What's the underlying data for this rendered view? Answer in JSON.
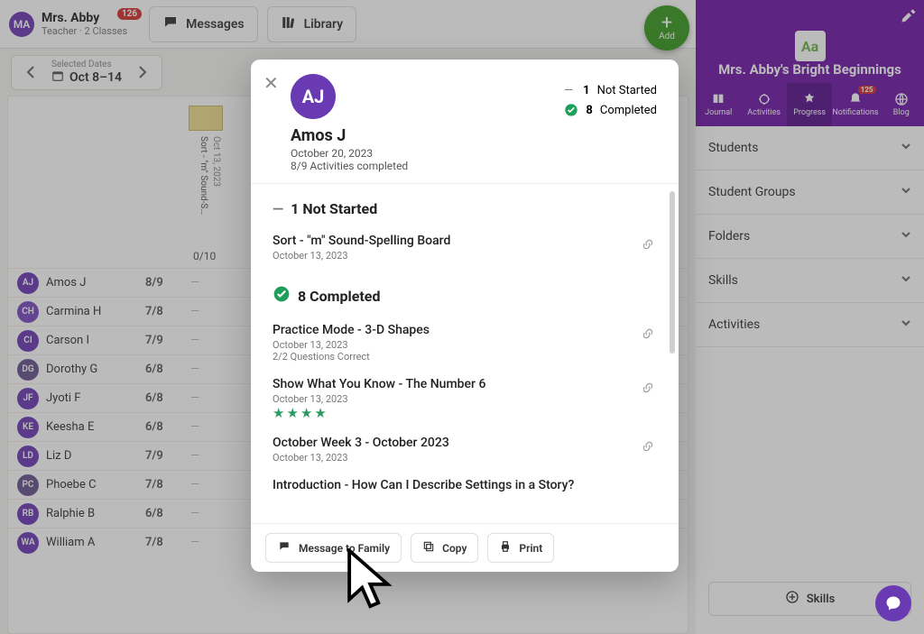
{
  "topbar": {
    "user_initials": "MA",
    "user_name": "Mrs. Abby",
    "user_role": "Teacher · 2 Classes",
    "badge": "126",
    "messages_label": "Messages",
    "library_label": "Library"
  },
  "add_fab": {
    "label": "Add"
  },
  "datebar": {
    "selected_label": "Selected Dates",
    "range": "Oct 8–14"
  },
  "column": {
    "activity_title": "Sort - \"m\" Sound-S…",
    "activity_date": "Oct 13, 2023",
    "counter": "0/10"
  },
  "students": [
    {
      "initials": "AJ",
      "name": "Amos J",
      "score": "8/9",
      "color": "#6a3ab2"
    },
    {
      "initials": "CH",
      "name": "Carmina H",
      "score": "7/8",
      "color": "#7a4bbf"
    },
    {
      "initials": "CI",
      "name": "Carson I",
      "score": "7/9",
      "color": "#6a3ab2"
    },
    {
      "initials": "DG",
      "name": "Dorothy G",
      "score": "6/8",
      "color": "#67548f"
    },
    {
      "initials": "JF",
      "name": "Jyoti F",
      "score": "6/8",
      "color": "#6a3ab2"
    },
    {
      "initials": "KE",
      "name": "Keesha E",
      "score": "6/8",
      "color": "#6a3ab2"
    },
    {
      "initials": "LD",
      "name": "Liz D",
      "score": "7/9",
      "color": "#6a3ab2"
    },
    {
      "initials": "PC",
      "name": "Phoebe C",
      "score": "7/8",
      "color": "#67548f"
    },
    {
      "initials": "RB",
      "name": "Ralphie B",
      "score": "6/8",
      "color": "#6a3ab2"
    },
    {
      "initials": "WA",
      "name": "William A",
      "score": "7/8",
      "color": "#6a3ab2"
    }
  ],
  "rpanel": {
    "class_name": "Mrs. Abby's Bright Beginnings",
    "tabs": {
      "journal": "Journal",
      "activities": "Activities",
      "progress": "Progress",
      "notifications": "Notifications",
      "notifications_badge": "125",
      "blog": "Blog"
    },
    "acc": {
      "students": "Students",
      "groups": "Student Groups",
      "folders": "Folders",
      "skills": "Skills",
      "activities": "Activities"
    },
    "skills_btn": "Skills"
  },
  "modal": {
    "initials": "AJ",
    "name": "Amos J",
    "date": "October 20, 2023",
    "completed_line": "8/9 Activities completed",
    "summary_not_started_num": "1",
    "summary_not_started_label": "Not Started",
    "summary_completed_num": "8",
    "summary_completed_label": "Completed",
    "section_not_started": "1 Not Started",
    "section_completed": "8 Completed",
    "items_not_started": [
      {
        "title": "Sort - \"m\" Sound-Spelling Board",
        "date": "October 13, 2023"
      }
    ],
    "items_completed": [
      {
        "title": "Practice Mode - 3-D Shapes",
        "date": "October 13, 2023",
        "extra": "2/2 Questions Correct"
      },
      {
        "title": "Show What You Know - The Number 6",
        "date": "October 13, 2023",
        "stars": 4
      },
      {
        "title": "October Week 3 - October 2023",
        "date": "October 13, 2023"
      },
      {
        "title": "Introduction - How Can I Describe Settings in a Story?",
        "date": ""
      }
    ],
    "footer": {
      "message": "Message to Family",
      "copy": "Copy",
      "print": "Print"
    }
  }
}
